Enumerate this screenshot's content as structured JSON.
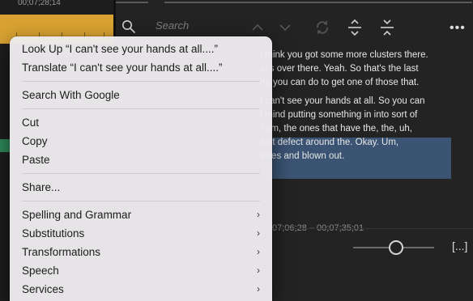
{
  "timeline": {
    "timecode": "00;07;28;14"
  },
  "search": {
    "placeholder": "Search"
  },
  "transcript": {
    "lines": [
      "I think you got some more clusters there.",
      "at's over there.  Yeah. So that's the last",
      "ng you  can do to get one of those  that.",
      "I can't see your hands at all. So you can",
      "t mind putting something in into  sort of",
      "form, the ones that have the,  the,  uh,",
      "fect  defect around the.  Okay.  Um,",
      "scles and blown out."
    ]
  },
  "timestamps": {
    "text": "07;06;28 – 00;07;35;01"
  },
  "zoom": {
    "bracket_label": "[...]"
  },
  "colors": {
    "accent_highlight": "#3b5473",
    "clip": "#d9a232",
    "menu_bg": "#eceaec"
  },
  "context_menu": {
    "groups": [
      [
        {
          "label": "Look Up “I can't see your hands at all....”",
          "submenu": false
        },
        {
          "label": "Translate “I can't see your hands at all....”",
          "submenu": false
        }
      ],
      [
        {
          "label": "Search With Google",
          "submenu": false
        }
      ],
      [
        {
          "label": "Cut",
          "submenu": false
        },
        {
          "label": "Copy",
          "submenu": false
        },
        {
          "label": "Paste",
          "submenu": false
        }
      ],
      [
        {
          "label": "Share...",
          "submenu": false
        }
      ],
      [
        {
          "label": "Spelling and Grammar",
          "submenu": true
        },
        {
          "label": "Substitutions",
          "submenu": true
        },
        {
          "label": "Transformations",
          "submenu": true
        },
        {
          "label": "Speech",
          "submenu": true
        },
        {
          "label": "Services",
          "submenu": true
        }
      ]
    ],
    "submenu_arrow": "›"
  }
}
